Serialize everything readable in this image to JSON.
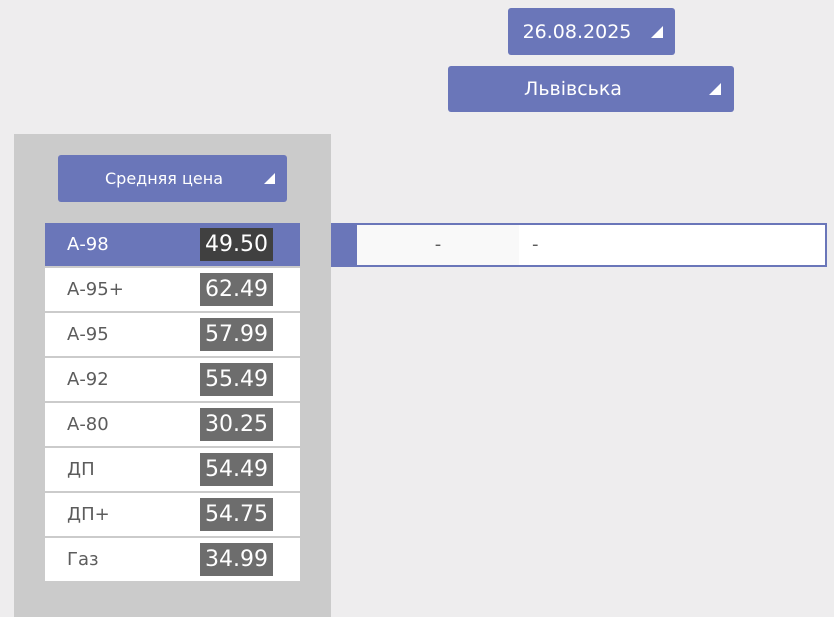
{
  "filters": {
    "date": "26.08.2025",
    "region": "Львівська",
    "price_type": "Средняя цена"
  },
  "fuels": [
    {
      "name": "А-98",
      "price": "49.50",
      "selected": true
    },
    {
      "name": "А-95+",
      "price": "62.49",
      "selected": false
    },
    {
      "name": "А-95",
      "price": "57.99",
      "selected": false
    },
    {
      "name": "А-92",
      "price": "55.49",
      "selected": false
    },
    {
      "name": "А-80",
      "price": "30.25",
      "selected": false
    },
    {
      "name": "ДП",
      "price": "54.49",
      "selected": false
    },
    {
      "name": "ДП+",
      "price": "54.75",
      "selected": false
    },
    {
      "name": "Газ",
      "price": "34.99",
      "selected": false
    }
  ],
  "detail": {
    "value_1": "-",
    "value_2": "-"
  },
  "colors": {
    "accent": "#6a76b9",
    "background": "#eeedee",
    "panel": "#cbcbcb",
    "price_badge": "#6d6d6d",
    "price_badge_selected": "#404040"
  }
}
